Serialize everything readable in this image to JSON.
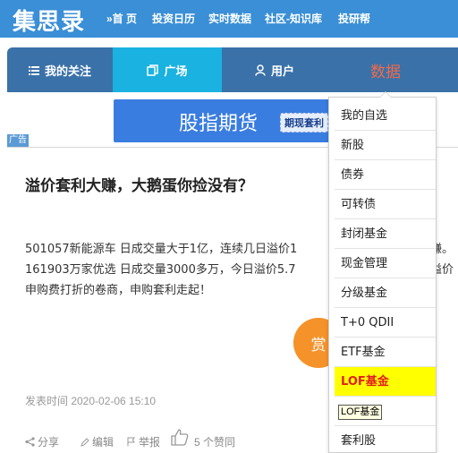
{
  "header": {
    "logo": "集思录",
    "nav": [
      "»首 页",
      "投资日历",
      "实时数据",
      "社区-知识库",
      "投研帮"
    ]
  },
  "navbar": {
    "tabs": [
      "我的关注",
      "广场",
      "用户",
      "数据"
    ],
    "active_tab": "广场"
  },
  "ad": {
    "banner_title": "股指期货",
    "banner_subtitle": "期现套利",
    "label": "广告"
  },
  "article": {
    "title": "溢价套利大赚，大鹅蛋你捡没有？",
    "lines": [
      "501057新能源车 日成交量大于1亿，连续几日溢价1",
      "161903万家优选 日成交量3000多万，今日溢价5.7",
      "申购费打折的卷商，申购套利走起！"
    ],
    "line_suffix_1": "赚。",
    "line_suffix_2": "溢价",
    "reward_label": "赏",
    "post_time": "发表时间 2020-02-06 15:10",
    "actions": {
      "share": "分享",
      "edit": "编辑",
      "report": "举报",
      "likes": "5 个赞同"
    }
  },
  "dropdown": {
    "items": [
      "我的自选",
      "新股",
      "债券",
      "可转债",
      "封闭基金",
      "现金管理",
      "分级基金",
      "T+0 QDII",
      "ETF基金",
      "LOF基金",
      "",
      "套利股"
    ],
    "highlighted": "LOF基金",
    "tooltip": "LOF基金"
  },
  "colors": {
    "header_bg": "#3a8fd6",
    "navbar_bg": "#3a71a8",
    "active_tab_bg": "#1ab2e0",
    "data_tab_text": "#f16a4a",
    "highlight_bg": "#ffff00",
    "highlight_text": "#e01e1e",
    "reward_button": "#f5922a"
  }
}
